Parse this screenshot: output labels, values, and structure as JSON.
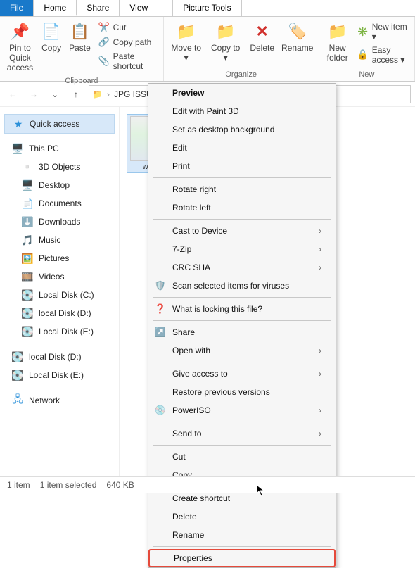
{
  "tabs": {
    "file": "File",
    "home": "Home",
    "share": "Share",
    "view": "View",
    "picture_tools": "Picture Tools"
  },
  "ribbon": {
    "clipboard": {
      "label": "Clipboard",
      "pin": "Pin to Quick access",
      "copy": "Copy",
      "paste": "Paste",
      "cut": "Cut",
      "copy_path": "Copy path",
      "paste_shortcut": "Paste shortcut"
    },
    "organize": {
      "label": "Organize",
      "move_to": "Move to ▾",
      "copy_to": "Copy to ▾",
      "delete": "Delete",
      "rename": "Rename"
    },
    "new": {
      "label": "New",
      "new_folder": "New folder",
      "new_item": "New item ▾",
      "easy_access": "Easy access ▾"
    }
  },
  "breadcrumb": {
    "folder": "JPG ISSUES",
    "chevron": "›"
  },
  "tree": {
    "quick_access": "Quick access",
    "this_pc": "This PC",
    "items": [
      {
        "label": "3D Objects",
        "icon": "cube-icon",
        "color": "#2b90d9"
      },
      {
        "label": "Desktop",
        "icon": "desktop-icon",
        "color": "#2b90d9"
      },
      {
        "label": "Documents",
        "icon": "document-icon",
        "color": "#7fbf5a"
      },
      {
        "label": "Downloads",
        "icon": "download-icon",
        "color": "#7fbf5a"
      },
      {
        "label": "Music",
        "icon": "music-icon",
        "color": "#2b90d9"
      },
      {
        "label": "Pictures",
        "icon": "picture-icon",
        "color": "#2b90d9"
      },
      {
        "label": "Videos",
        "icon": "video-icon",
        "color": "#6a6a6a"
      },
      {
        "label": "Local Disk (C:)",
        "icon": "drive-icon",
        "color": "#8a8a8a"
      },
      {
        "label": "local Disk (D:)",
        "icon": "drive-icon",
        "color": "#8a8a8a"
      },
      {
        "label": "Local Disk (E:)",
        "icon": "drive-icon",
        "color": "#8a8a8a"
      }
    ],
    "extra": [
      {
        "label": "local Disk (D:)",
        "icon": "drive-icon"
      },
      {
        "label": "Local Disk (E:)",
        "icon": "drive-icon"
      }
    ],
    "network": "Network"
  },
  "file": {
    "name": "w..."
  },
  "context_menu": {
    "groups": [
      [
        {
          "label": "Preview",
          "bold": true
        },
        {
          "label": "Edit with Paint 3D"
        },
        {
          "label": "Set as desktop background"
        },
        {
          "label": "Edit"
        },
        {
          "label": "Print"
        }
      ],
      [
        {
          "label": "Rotate right"
        },
        {
          "label": "Rotate left"
        }
      ],
      [
        {
          "label": "Cast to Device",
          "submenu": true
        },
        {
          "label": "7-Zip",
          "submenu": true
        },
        {
          "label": "CRC SHA",
          "submenu": true
        },
        {
          "label": "Scan selected items for viruses",
          "icon": "shield-orange-icon"
        }
      ],
      [
        {
          "label": "What is locking this file?",
          "icon": "question-icon"
        }
      ],
      [
        {
          "label": "Share",
          "icon": "share-icon"
        },
        {
          "label": "Open with",
          "submenu": true
        }
      ],
      [
        {
          "label": "Give access to",
          "submenu": true
        },
        {
          "label": "Restore previous versions"
        },
        {
          "label": "PowerISO",
          "icon": "disc-yellow-icon",
          "submenu": true
        }
      ],
      [
        {
          "label": "Send to",
          "submenu": true
        }
      ],
      [
        {
          "label": "Cut"
        },
        {
          "label": "Copy"
        }
      ],
      [
        {
          "label": "Create shortcut"
        },
        {
          "label": "Delete"
        },
        {
          "label": "Rename"
        }
      ],
      [
        {
          "label": "Properties",
          "highlight": true
        }
      ]
    ]
  },
  "status": {
    "count": "1 item",
    "selected": "1 item selected",
    "size": "640 KB"
  }
}
